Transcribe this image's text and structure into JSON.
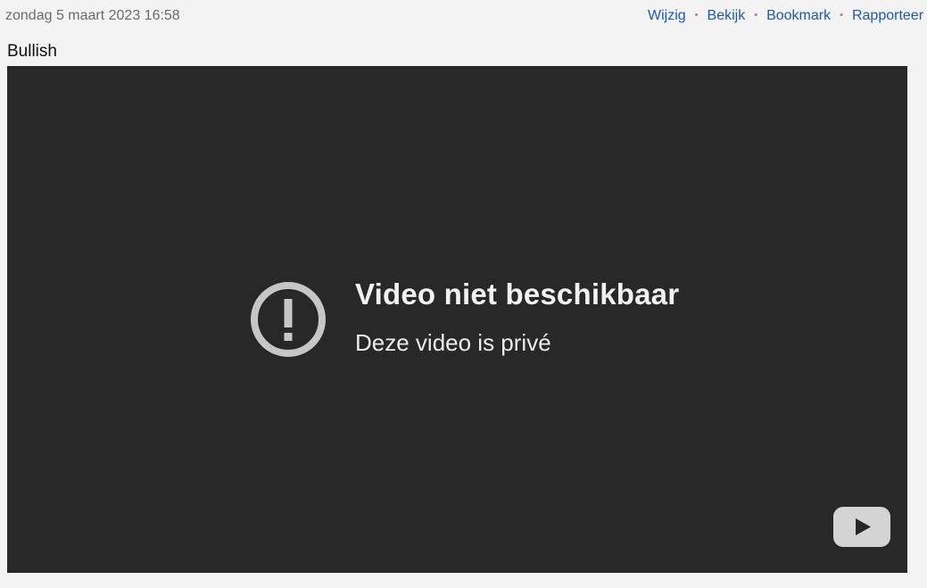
{
  "post": {
    "date": "zondag 5 maart 2023 16:58",
    "text": "Bullish",
    "actions": [
      {
        "label": "Wijzig"
      },
      {
        "label": "Bekijk"
      },
      {
        "label": "Bookmark"
      },
      {
        "label": "Rapporteer"
      }
    ],
    "separator": "•"
  },
  "video": {
    "error_title": "Video niet beschikbaar",
    "error_message": "Deze video is privé",
    "status_icon": "exclamation-circle-icon",
    "player_logo_icon": "youtube-logo-icon"
  },
  "colors": {
    "link": "#1a5aa8",
    "video_background": "#282828",
    "page_background": "#f3f3f3"
  }
}
